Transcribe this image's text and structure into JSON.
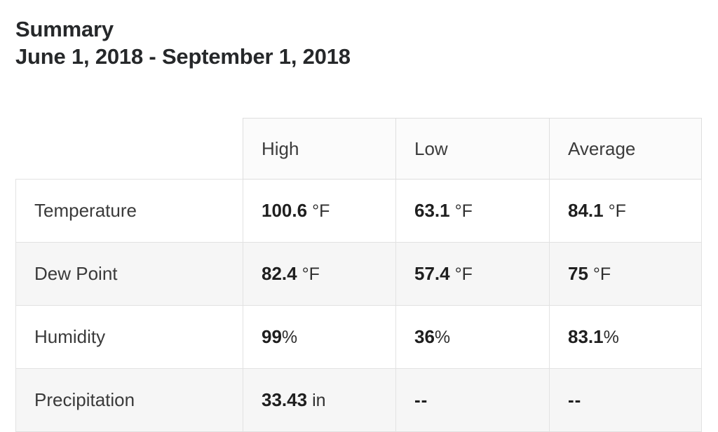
{
  "header": {
    "title": "Summary",
    "date_range": "June 1, 2018 - September 1, 2018"
  },
  "table": {
    "columns": [
      "",
      "High",
      "Low",
      "Average"
    ],
    "rows": [
      {
        "label": "Temperature",
        "high": {
          "value": "100.6",
          "unit": "°F",
          "spacing": "spaced"
        },
        "low": {
          "value": "63.1",
          "unit": "°F",
          "spacing": "spaced"
        },
        "average": {
          "value": "84.1",
          "unit": "°F",
          "spacing": "spaced"
        }
      },
      {
        "label": "Dew Point",
        "high": {
          "value": "82.4",
          "unit": "°F",
          "spacing": "spaced"
        },
        "low": {
          "value": "57.4",
          "unit": "°F",
          "spacing": "spaced"
        },
        "average": {
          "value": "75",
          "unit": "°F",
          "spacing": "spaced"
        }
      },
      {
        "label": "Humidity",
        "high": {
          "value": "99",
          "unit": "%",
          "spacing": "tight"
        },
        "low": {
          "value": "36",
          "unit": "%",
          "spacing": "tight"
        },
        "average": {
          "value": "83.1",
          "unit": "%",
          "spacing": "tight"
        }
      },
      {
        "label": "Precipitation",
        "high": {
          "value": "33.43",
          "unit": "in",
          "spacing": "spaced"
        },
        "low": {
          "value": "--",
          "unit": "",
          "spacing": "tight"
        },
        "average": {
          "value": "--",
          "unit": "",
          "spacing": "tight"
        }
      }
    ]
  },
  "colors": {
    "background": "#ffffff",
    "text": "#2b2b2b",
    "border": "#e2e2e2",
    "row_shade": "#f6f6f6",
    "header_shade": "#fbfbfb"
  }
}
